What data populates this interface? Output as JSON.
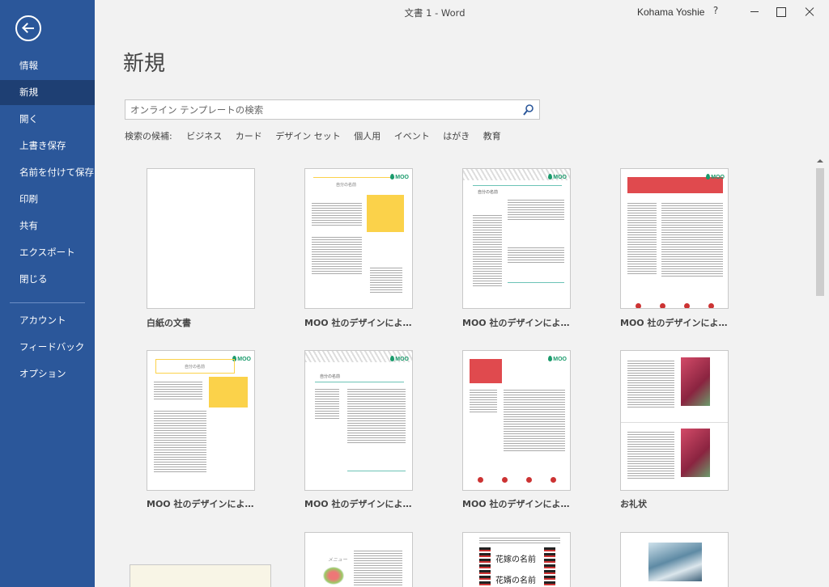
{
  "window": {
    "title": "文書 1  -  Word",
    "user": "Kohama Yoshie",
    "help": "?"
  },
  "sidebar": {
    "items": [
      {
        "label": "情報"
      },
      {
        "label": "新規"
      },
      {
        "label": "開く"
      },
      {
        "label": "上書き保存"
      },
      {
        "label": "名前を付けて保存"
      },
      {
        "label": "印刷"
      },
      {
        "label": "共有"
      },
      {
        "label": "エクスポート"
      },
      {
        "label": "閉じる"
      },
      {
        "label": "アカウント"
      },
      {
        "label": "フィードバック"
      },
      {
        "label": "オプション"
      }
    ],
    "active": "新規"
  },
  "main": {
    "title": "新規",
    "search": {
      "placeholder": "オンライン テンプレートの検索"
    },
    "suggestions": {
      "label": "検索の候補:",
      "items": [
        "ビジネス",
        "カード",
        "デザイン セット",
        "個人用",
        "イベント",
        "はがき",
        "教育"
      ]
    },
    "templates": [
      {
        "label": "白紙の文書"
      },
      {
        "label": "MOO 社のデザインによ…"
      },
      {
        "label": "MOO 社のデザインによ…"
      },
      {
        "label": "MOO 社のデザインによ…"
      },
      {
        "label": "MOO 社のデザインによ…"
      },
      {
        "label": "MOO 社のデザインによ…"
      },
      {
        "label": "MOO 社のデザインによ…"
      },
      {
        "label": "お礼状"
      }
    ],
    "thumb_text": {
      "name": "自分の名前",
      "moo": "MOO",
      "menu": "メニュー",
      "bride": "花嫁の名前",
      "groom": "花婿の名前"
    }
  },
  "colors": {
    "sidebar": "#2b579a",
    "active": "#1e3f73",
    "accent_red": "#e04a4e",
    "accent_yellow": "#fbd24a",
    "moo_green": "#1a9b6c"
  }
}
